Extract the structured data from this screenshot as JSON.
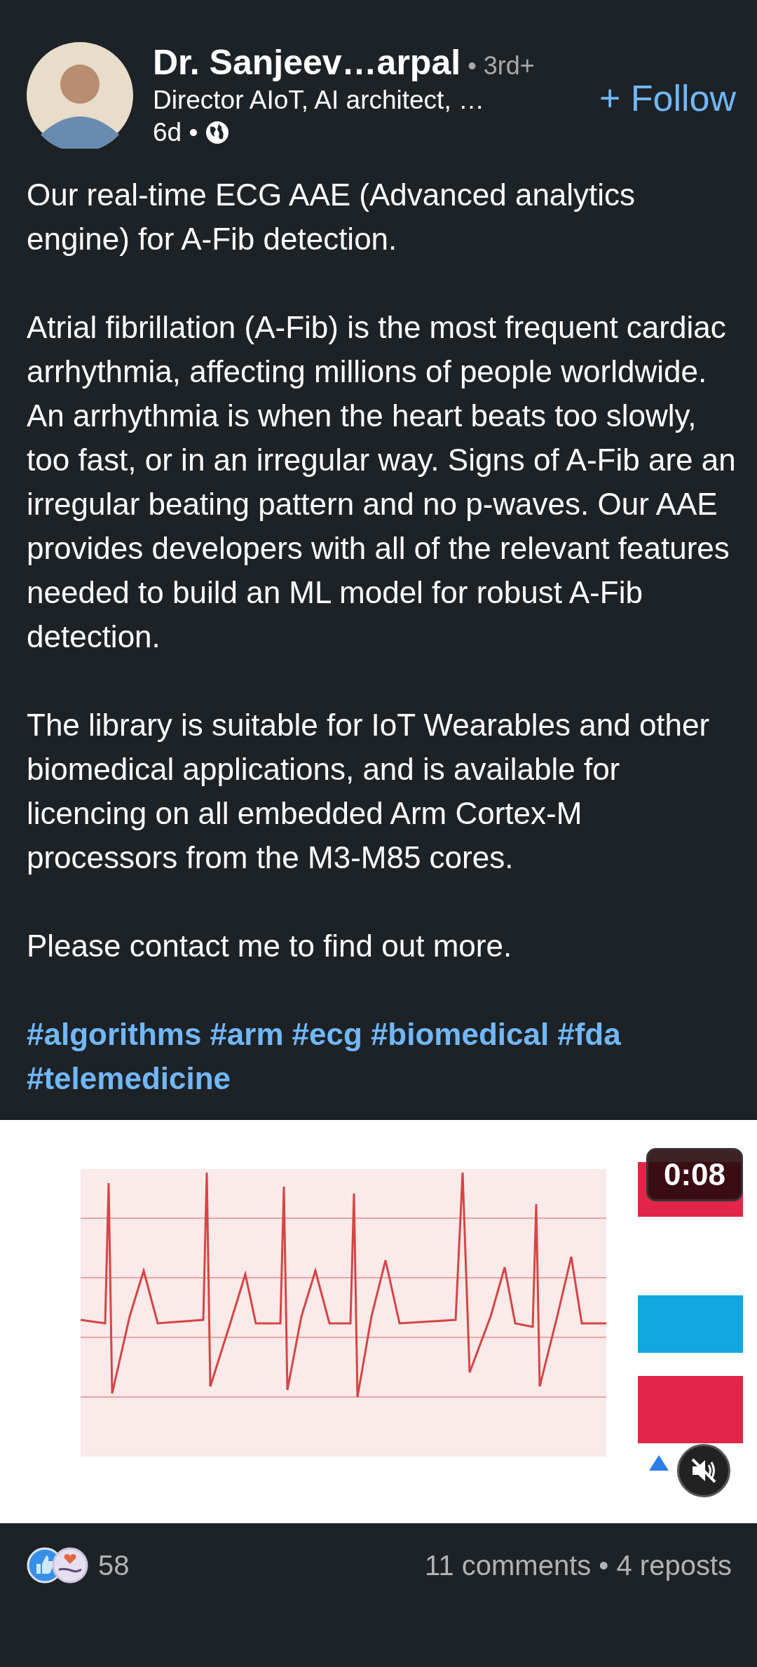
{
  "author": {
    "name": "Dr. Sanjeev…arpal",
    "degree": "• 3rd+",
    "headline": "Director AIoT, AI architect, …",
    "time": "6d •"
  },
  "follow_button": {
    "label": "+ Follow"
  },
  "post_text": [
    "Our real-time ECG AAE (Advanced analytics engine) for A-Fib detection.",
    "Atrial fibrillation (A-Fib) is the most frequent cardiac arrhythmia, affecting millions of people worldwide. An arrhythmia is when the heart beats too slowly, too fast, or in an irregular way. Signs of A-Fib are an irregular beating pattern and no p-waves. Our AAE provides developers with all of the relevant features needed to build an ML model for robust A-Fib detection.",
    "The library is suitable for IoT Wearables and other biomedical applications, and is available for licencing on all embedded Arm Cortex-M processors from the M3-M85 cores.",
    "Please contact me to find out more."
  ],
  "hashtags": [
    "#algorithms",
    "#arm",
    "#ecg",
    "#biomedical",
    "#fda",
    "#telemedicine"
  ],
  "video": {
    "kind": "picture",
    "duration": "0:08",
    "muted": true
  },
  "stats": {
    "reactions": "58",
    "comments": "11 comments • 4 reposts"
  }
}
